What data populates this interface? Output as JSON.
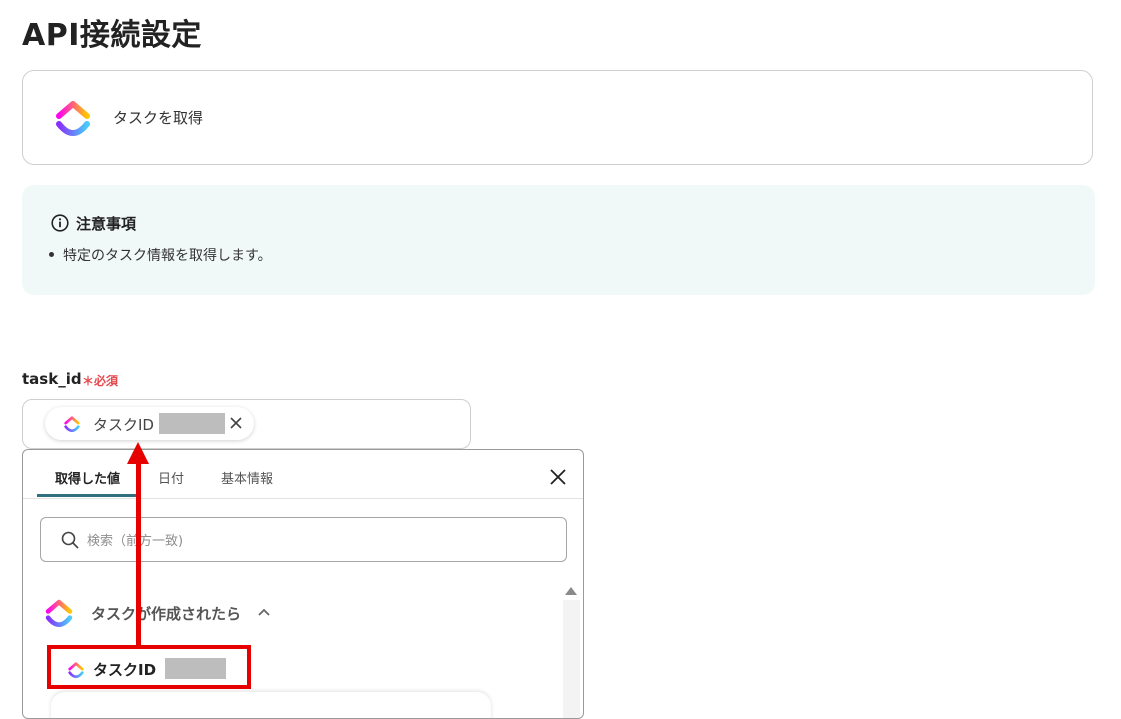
{
  "page": {
    "title": "API接続設定"
  },
  "app_card": {
    "action_label": "タスクを取得"
  },
  "notice": {
    "title": "注意事項",
    "bullets": [
      "特定のタスク情報を取得します。"
    ]
  },
  "field": {
    "label": "task_id",
    "required_label": "＊必須",
    "chip_label": "タスクID"
  },
  "popup": {
    "tabs": [
      "取得した値",
      "日付",
      "基本情報"
    ],
    "active_tab": "取得した値",
    "search_placeholder": "検索（前方一致)",
    "group_label": "タスクが作成されたら",
    "item_label": "タスクID"
  },
  "colors": {
    "accent": "#2f6f80",
    "required": "#e5484d",
    "annotation": "#e60000",
    "notice_bg": "#f1f9f8"
  },
  "icons": [
    "clickup-logo",
    "info-icon",
    "close-icon",
    "search-icon",
    "chevron-up-icon"
  ]
}
